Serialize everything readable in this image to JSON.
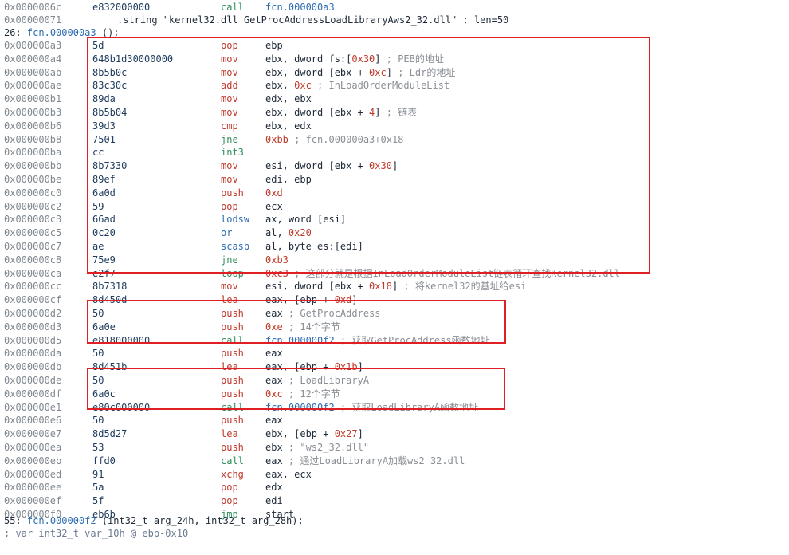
{
  "top_rows": [
    {
      "addr": "0x0000006c",
      "bytes": "e832000000",
      "mnemonic": "call",
      "mn_color": "#2f8f5b",
      "ops": "fcn.000000a3"
    },
    {
      "addr": "0x00000071",
      "rest": ".string \"kernel32.dll GetProcAddressLoadLibraryAws2_32.dll\" ; len=50"
    }
  ],
  "func_header_1": {
    "number": "26:",
    "name": "fcn.000000a3",
    "suffix": " ();"
  },
  "rows": [
    {
      "addr": "0x000000a3",
      "bytes": "5d",
      "mnemonic": "pop",
      "mn_color": "#c0392b",
      "ops": "ebp"
    },
    {
      "addr": "0x000000a4",
      "bytes": "648b1d30000000",
      "mnemonic": "mov",
      "mn_color": "#c0392b",
      "ops": "ebx, dword fs:[",
      "num": "0x30",
      "ops_after": "]",
      "comment": " ; PEB的地址"
    },
    {
      "addr": "0x000000ab",
      "bytes": "8b5b0c",
      "mnemonic": "mov",
      "mn_color": "#c0392b",
      "ops": "ebx, dword [ebx + ",
      "num": "0xc",
      "ops_after": "]",
      "comment": " ; Ldr的地址"
    },
    {
      "addr": "0x000000ae",
      "bytes": "83c30c",
      "mnemonic": "add",
      "mn_color": "#c0392b",
      "ops": "ebx, ",
      "num": "0xc",
      "ops_after": "",
      "comment": " ; InLoadOrderModuleList"
    },
    {
      "addr": "0x000000b1",
      "bytes": "89da",
      "mnemonic": "mov",
      "mn_color": "#c0392b",
      "ops": "edx, ebx"
    },
    {
      "addr": "0x000000b3",
      "bytes": "8b5b04",
      "mnemonic": "mov",
      "mn_color": "#c0392b",
      "ops": "ebx, dword [ebx + ",
      "num": "4",
      "ops_after": "]",
      "comment": " ; 链表"
    },
    {
      "addr": "0x000000b6",
      "bytes": "39d3",
      "mnemonic": "cmp",
      "mn_color": "#c0392b",
      "ops": "ebx, edx"
    },
    {
      "addr": "0x000000b8",
      "bytes": "7501",
      "mnemonic": "jne",
      "mn_color": "#2f8f5b",
      "ops": "",
      "num": "0xbb",
      "ops_after": "",
      "comment": " ; fcn.000000a3+0x18"
    },
    {
      "addr": "0x000000ba",
      "bytes": "cc",
      "mnemonic": "int3",
      "mn_color": "#2f8f5b",
      "ops": ""
    },
    {
      "addr": "0x000000bb",
      "bytes": "8b7330",
      "mnemonic": "mov",
      "mn_color": "#c0392b",
      "ops": "esi, dword [ebx + ",
      "num": "0x30",
      "ops_after": "]"
    },
    {
      "addr": "0x000000be",
      "bytes": "89ef",
      "mnemonic": "mov",
      "mn_color": "#c0392b",
      "ops": "edi, ebp"
    },
    {
      "addr": "0x000000c0",
      "bytes": "6a0d",
      "mnemonic": "push",
      "mn_color": "#c0392b",
      "ops": "",
      "num": "0xd",
      "ops_after": ""
    },
    {
      "addr": "0x000000c2",
      "bytes": "59",
      "mnemonic": "pop",
      "mn_color": "#c0392b",
      "ops": "ecx"
    },
    {
      "addr": "0x000000c3",
      "bytes": "66ad",
      "mnemonic": "lodsw",
      "mn_color": "#2d6cb0",
      "ops": "ax, word [esi]"
    },
    {
      "addr": "0x000000c5",
      "bytes": "0c20",
      "mnemonic": "or",
      "mn_color": "#2d6cb0",
      "ops": "al, ",
      "num": "0x20",
      "ops_after": ""
    },
    {
      "addr": "0x000000c7",
      "bytes": "ae",
      "mnemonic": "scasb",
      "mn_color": "#2d6cb0",
      "ops": "al, byte es:[edi]"
    },
    {
      "addr": "0x000000c8",
      "bytes": "75e9",
      "mnemonic": "jne",
      "mn_color": "#2f8f5b",
      "ops": "",
      "num": "0xb3",
      "ops_after": ""
    },
    {
      "addr": "0x000000ca",
      "bytes": "e2f7",
      "mnemonic": "loop",
      "mn_color": "#2f8f5b",
      "ops": "",
      "num": "0xc3",
      "ops_after": "",
      "comment": " ; 这部分就是根据InLoadOrderModuleList链表循环查找Kernel32.dll"
    },
    {
      "addr": "0x000000cc",
      "bytes": "8b7318",
      "mnemonic": "mov",
      "mn_color": "#c0392b",
      "ops": "esi, dword [ebx + ",
      "num": "0x18",
      "ops_after": "]",
      "comment": " ; 将kernel32的基址给esi"
    },
    {
      "addr": "0x000000cf",
      "bytes": "8d450d",
      "mnemonic": "lea",
      "mn_color": "#c0392b",
      "ops": "eax, [ebp + ",
      "num": "0xd",
      "ops_after": "]"
    },
    {
      "addr": "0x000000d2",
      "bytes": "50",
      "mnemonic": "push",
      "mn_color": "#c0392b",
      "ops": "eax",
      "comment": " ; GetProcAddress"
    },
    {
      "addr": "0x000000d3",
      "bytes": "6a0e",
      "mnemonic": "push",
      "mn_color": "#c0392b",
      "ops": "",
      "num": "0xe",
      "ops_after": "",
      "comment": " ; 14个字节"
    },
    {
      "addr": "0x000000d5",
      "bytes": "e818000000",
      "mnemonic": "call",
      "mn_color": "#2f8f5b",
      "ops": "fcn.000000f2",
      "comment": " ; 获取GetProcAddress函数地址"
    },
    {
      "addr": "0x000000da",
      "bytes": "50",
      "mnemonic": "push",
      "mn_color": "#c0392b",
      "ops": "eax"
    },
    {
      "addr": "0x000000db",
      "bytes": "8d451b",
      "mnemonic": "lea",
      "mn_color": "#c0392b",
      "ops": "eax, [ebp + ",
      "num": "0x1b",
      "ops_after": "]"
    },
    {
      "addr": "0x000000de",
      "bytes": "50",
      "mnemonic": "push",
      "mn_color": "#c0392b",
      "ops": "eax",
      "comment": " ; LoadLibraryA"
    },
    {
      "addr": "0x000000df",
      "bytes": "6a0c",
      "mnemonic": "push",
      "mn_color": "#c0392b",
      "ops": "",
      "num": "0xc",
      "ops_after": "",
      "comment": " ; 12个字节"
    },
    {
      "addr": "0x000000e1",
      "bytes": "e80c000000",
      "mnemonic": "call",
      "mn_color": "#2f8f5b",
      "ops": "fcn.000000f2",
      "comment": " ; 获取LoadLibraryA函数地址"
    },
    {
      "addr": "0x000000e6",
      "bytes": "50",
      "mnemonic": "push",
      "mn_color": "#c0392b",
      "ops": "eax"
    },
    {
      "addr": "0x000000e7",
      "bytes": "8d5d27",
      "mnemonic": "lea",
      "mn_color": "#c0392b",
      "ops": "ebx, [ebp + ",
      "num": "0x27",
      "ops_after": "]"
    },
    {
      "addr": "0x000000ea",
      "bytes": "53",
      "mnemonic": "push",
      "mn_color": "#c0392b",
      "ops": "ebx",
      "comment": " ; \"ws2_32.dll\""
    },
    {
      "addr": "0x000000eb",
      "bytes": "ffd0",
      "mnemonic": "call",
      "mn_color": "#2f8f5b",
      "ops": "eax",
      "comment": " ; 通过LoadLibraryA加载ws2_32.dll"
    },
    {
      "addr": "0x000000ed",
      "bytes": "91",
      "mnemonic": "xchg",
      "mn_color": "#c0392b",
      "ops": "eax, ecx"
    },
    {
      "addr": "0x000000ee",
      "bytes": "5a",
      "mnemonic": "pop",
      "mn_color": "#c0392b",
      "ops": "edx"
    },
    {
      "addr": "0x000000ef",
      "bytes": "5f",
      "mnemonic": "pop",
      "mn_color": "#c0392b",
      "ops": "edi"
    },
    {
      "addr": "0x000000f0",
      "bytes": "eb6b",
      "mnemonic": "jmp",
      "mn_color": "#2f8f5b",
      "ops": "start"
    }
  ],
  "func_header_2": {
    "number": "55:",
    "name": "fcn.000000f2",
    "suffix": " (int32_t arg_24h, int32_t arg_28h);"
  },
  "var_line": "; var int32_t var_10h @ ebp-0x10",
  "accent_box_color": "#e01f24"
}
